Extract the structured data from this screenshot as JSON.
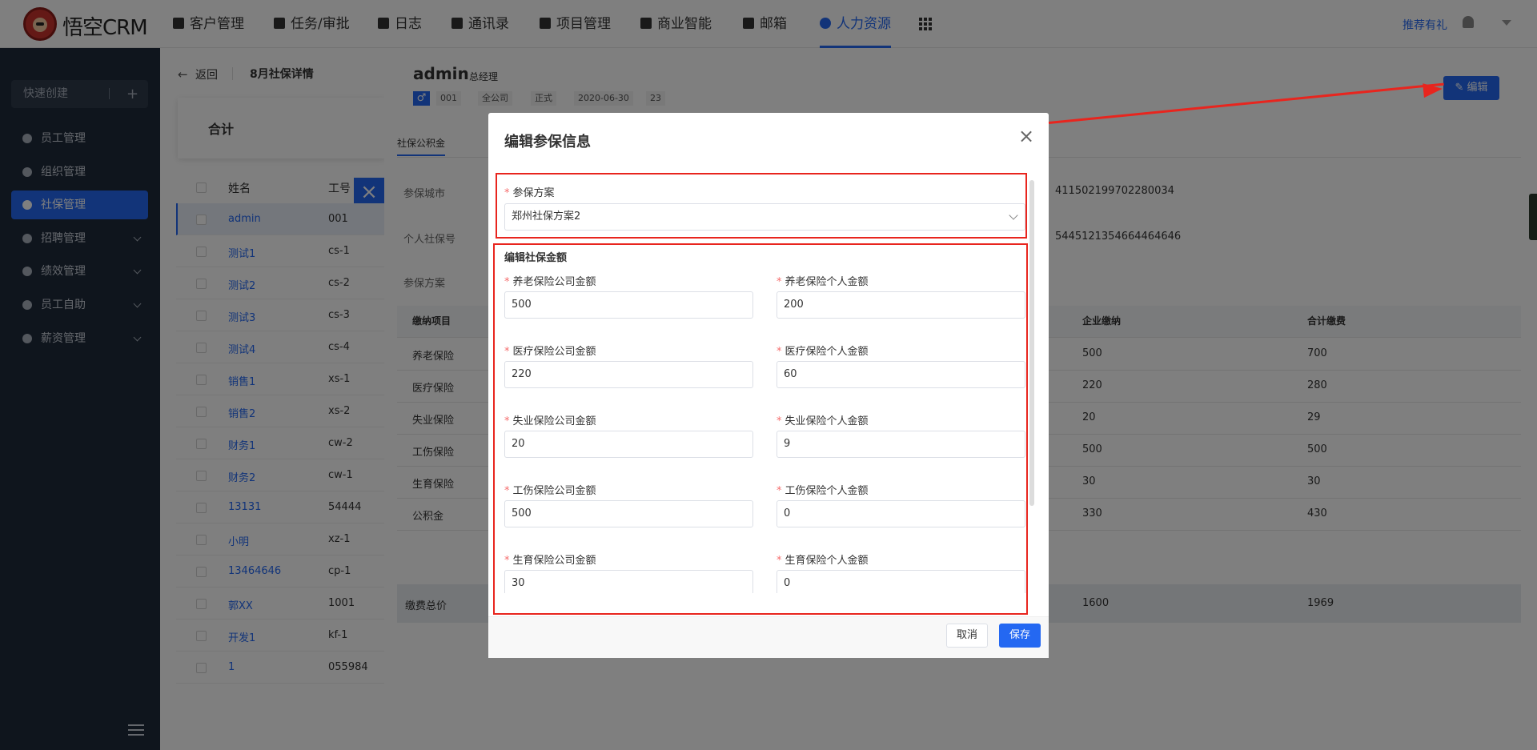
{
  "header": {
    "logo_text": "悟空CRM",
    "nav": [
      {
        "label": "客户管理",
        "icon": "building-icon"
      },
      {
        "label": "任务/审批",
        "icon": "briefcase-icon"
      },
      {
        "label": "日志",
        "icon": "note-icon"
      },
      {
        "label": "通讯录",
        "icon": "phone-book-icon"
      },
      {
        "label": "项目管理",
        "icon": "list-icon"
      },
      {
        "label": "商业智能",
        "icon": "chart-icon"
      },
      {
        "label": "邮箱",
        "icon": "mail-icon"
      },
      {
        "label": "人力资源",
        "icon": "person-icon",
        "active": true
      }
    ],
    "apps_icon": "apps-grid-icon",
    "recommend": "推荐有礼",
    "accent": "#2468f2"
  },
  "sidebar": {
    "quick_create": "快速创建",
    "items": [
      {
        "label": "员工管理"
      },
      {
        "label": "组织管理"
      },
      {
        "label": "社保管理",
        "active": true
      },
      {
        "label": "招聘管理",
        "expandable": true
      },
      {
        "label": "绩效管理",
        "expandable": true
      },
      {
        "label": "员工自助",
        "expandable": true
      },
      {
        "label": "薪资管理",
        "expandable": true
      }
    ]
  },
  "list_panel": {
    "back": "返回",
    "title": "8月社保详情",
    "summary": "合计",
    "col_name": "姓名",
    "col_id": "工号",
    "rows": [
      {
        "name": "admin",
        "id": "001"
      },
      {
        "name": "测试1",
        "id": "cs-1"
      },
      {
        "name": "测试2",
        "id": "cs-2"
      },
      {
        "name": "测试3",
        "id": "cs-3"
      },
      {
        "name": "测试4",
        "id": "cs-4"
      },
      {
        "name": "销售1",
        "id": "xs-1"
      },
      {
        "name": "销售2",
        "id": "xs-2"
      },
      {
        "name": "财务1",
        "id": "cw-2"
      },
      {
        "name": "财务2",
        "id": "cw-1"
      },
      {
        "name": "13131",
        "id": "54444"
      },
      {
        "name": "小明",
        "id": "xz-1"
      },
      {
        "name": "13464646",
        "id": "cp-1"
      },
      {
        "name": "郭XX",
        "id": "1001"
      },
      {
        "name": "开发1",
        "id": "kf-1"
      },
      {
        "name": "1",
        "id": "055984"
      }
    ]
  },
  "detail": {
    "name": "admin",
    "role": "总经理",
    "gender": "♂",
    "tags": [
      "001",
      "全公司",
      "正式",
      "2020-06-30",
      "23"
    ],
    "edit": "编辑",
    "tab": "社保公积金",
    "city_label": "参保城市",
    "social_no_label": "个人社保号",
    "plan_label": "参保方案",
    "id_card": "411502199702280034",
    "social_no": "5445121354664464646",
    "table": {
      "headers": [
        "缴纳项目",
        "企业缴纳",
        "合计缴费"
      ],
      "rows": [
        {
          "item": "养老保险",
          "company": "500",
          "total": "700"
        },
        {
          "item": "医疗保险",
          "company": "220",
          "total": "280"
        },
        {
          "item": "失业保险",
          "company": "20",
          "total": "29"
        },
        {
          "item": "工伤保险",
          "company": "500",
          "total": "500"
        },
        {
          "item": "生育保险",
          "company": "30",
          "total": "30"
        },
        {
          "item": "公积金",
          "company": "330",
          "total": "430"
        }
      ],
      "total_label": "缴费总价",
      "total_company": "1600",
      "total_sum": "1969"
    }
  },
  "modal": {
    "title": "编辑参保信息",
    "plan_label": "参保方案",
    "plan_value": "郑州社保方案2",
    "section": "编辑社保金额",
    "fields": [
      {
        "label": "养老保险公司金额",
        "value": "500"
      },
      {
        "label": "养老保险个人金额",
        "value": "200"
      },
      {
        "label": "医疗保险公司金额",
        "value": "220"
      },
      {
        "label": "医疗保险个人金额",
        "value": "60"
      },
      {
        "label": "失业保险公司金额",
        "value": "20"
      },
      {
        "label": "失业保险个人金额",
        "value": "9"
      },
      {
        "label": "工伤保险公司金额",
        "value": "500"
      },
      {
        "label": "工伤保险个人金额",
        "value": "0"
      },
      {
        "label": "生育保险公司金额",
        "value": "30"
      },
      {
        "label": "生育保险个人金额",
        "value": "0"
      }
    ],
    "cancel": "取消",
    "save": "保存"
  }
}
